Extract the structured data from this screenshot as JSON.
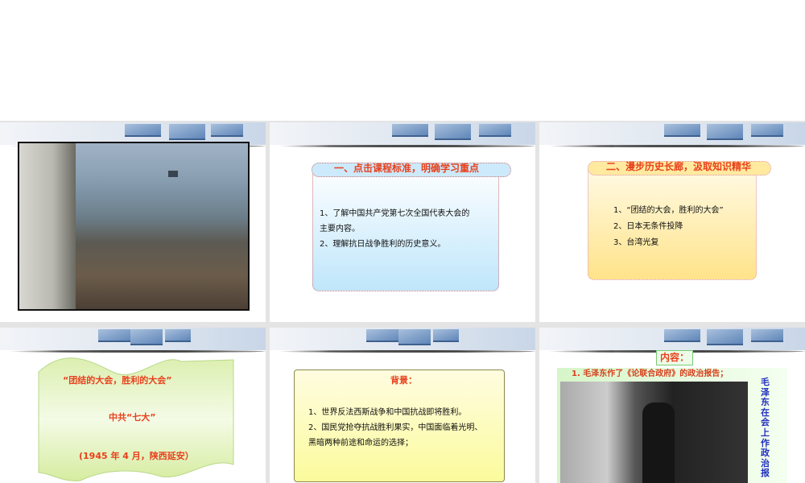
{
  "slides": [
    {
      "index": 1,
      "kind": "photo"
    },
    {
      "index": 2,
      "title": "一、点击课程标准，明确学习重点",
      "lines": [
        "1、了解中国共产党第七次全国代表大会的",
        "主要内容。",
        "2、理解抗日战争胜利的历史意义。"
      ]
    },
    {
      "index": 3,
      "title": "二、漫步历史长廊，汲取知识精华",
      "lines": [
        "1、“团结的大会，胜利的大会”",
        "2、日本无条件投降",
        "3、台湾光复"
      ]
    },
    {
      "index": 4,
      "lines": [
        "“团结的大会，胜利的大会”",
        "中共“七大”",
        "(1945 年 4 月，陕西延安）"
      ]
    },
    {
      "index": 5,
      "title": "背景：",
      "lines": [
        "1、世界反法西斯战争和中国抗战即将胜利。",
        "2、国民党抢夺抗战胜利果实，中国面临着光明、",
        "黑暗两种前途和命运的选择；"
      ]
    },
    {
      "index": 6,
      "title": "内容：",
      "subtitle": "1. 毛泽东作了《论联合政府》的政治报告；",
      "caption": "毛泽东在会上作政治报"
    }
  ],
  "colors": {
    "accent": "#e8401c",
    "caption": "#1f2fbf"
  }
}
